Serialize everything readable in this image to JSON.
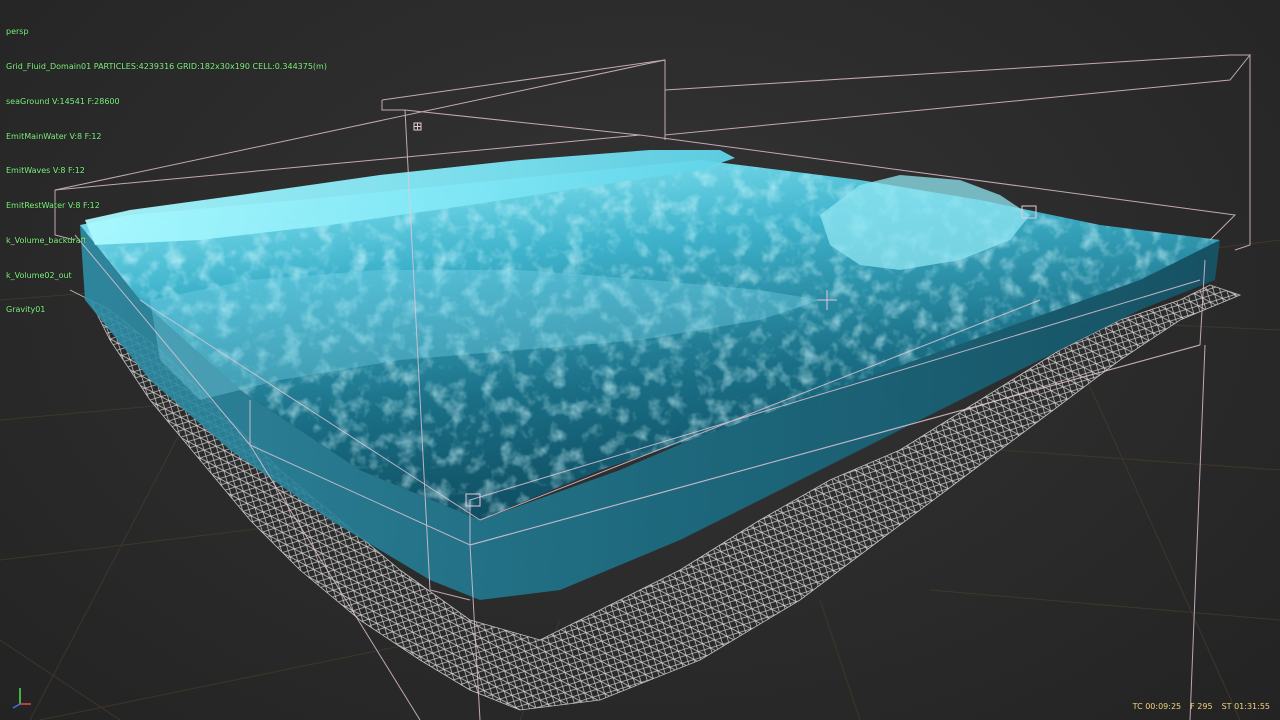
{
  "viewport": {
    "camera": "persp",
    "outliner": [
      "Grid_Fluid_Domain01 PARTICLES:4239316 GRID:182x30x190 CELL:0.344375(m)",
      "seaGround V:14541 F:28600",
      "EmitMainWater V:8 F:12",
      "EmitWaves V:8 F:12",
      "EmitRestWater V:8 F:12",
      "k_Volume_backdraft",
      "k_Volume02_out",
      "Gravity01"
    ]
  },
  "status": {
    "tc": "TC 00:09:25",
    "frame": "F 295",
    "st": "ST 01:31:55"
  },
  "colors": {
    "background": "#2b2b2b",
    "grid": "#4a3d2a",
    "hud_text": "#7df27d",
    "timecode_text": "#f2d27a",
    "water_light": "#8ff0ff",
    "water_mid": "#2f9cb8",
    "water_deep": "#0f4a5e",
    "wireframe": "#e8c8d8",
    "ground_mesh": "#f2f2f2"
  },
  "icons": {
    "axis_gizmo": "xyz-axis-icon",
    "locator": "locator-icon"
  }
}
